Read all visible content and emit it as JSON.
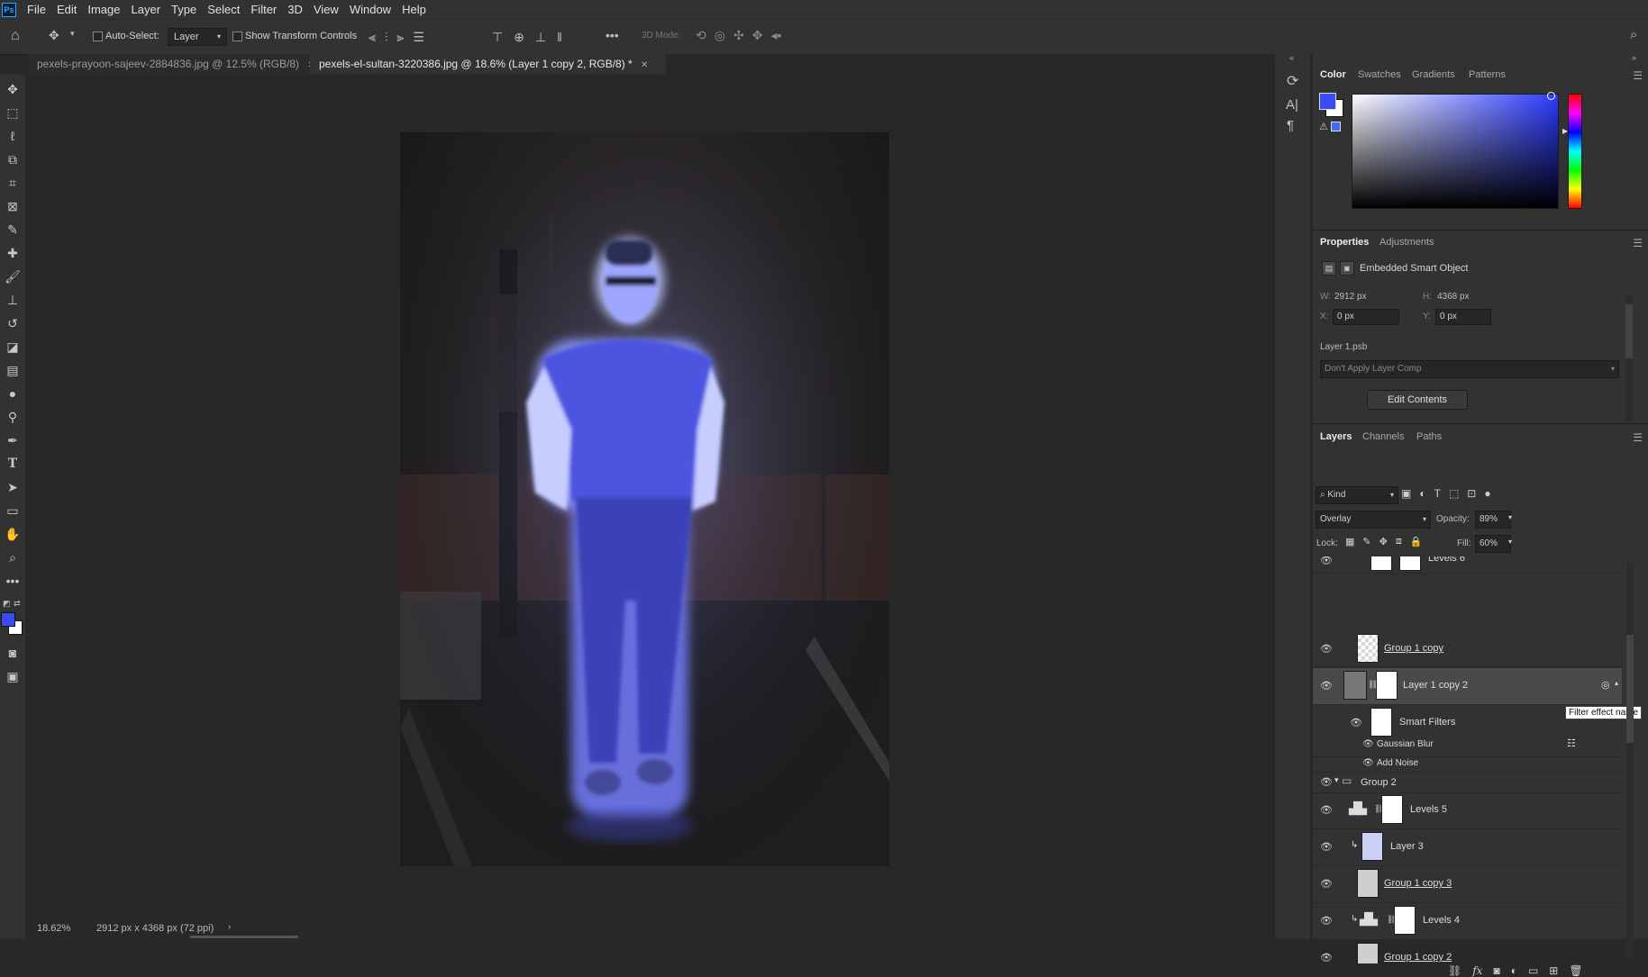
{
  "menubar": {
    "logo": "Ps",
    "items": [
      "File",
      "Edit",
      "Image",
      "Layer",
      "Type",
      "Select",
      "Filter",
      "3D",
      "View",
      "Window",
      "Help"
    ]
  },
  "options": {
    "auto_select_label": "Auto-Select:",
    "auto_select_value": "Layer",
    "show_transform_label": "Show Transform Controls",
    "mode_3d_label": "3D Mode:"
  },
  "tabs": [
    {
      "label": "pexels-prayoon-sajeev-2884836.jpg @ 12.5% (RGB/8)",
      "active": false
    },
    {
      "label": "pexels-el-sultan-3220386.jpg @ 18.6% (Layer 1 copy 2, RGB/8) *",
      "active": true
    }
  ],
  "status": {
    "zoom": "18.62%",
    "doc_info": "2912 px x 4368 px (72 ppi)"
  },
  "colors": {
    "foreground": "#3a4cf5",
    "background": "#ffffff",
    "accent": "#2a3aff"
  },
  "color_panel": {
    "tabs": [
      "Color",
      "Swatches",
      "Gradients",
      "Patterns"
    ],
    "active": "Color"
  },
  "properties": {
    "tabs": [
      "Properties",
      "Adjustments"
    ],
    "active": "Properties",
    "type_label": "Embedded Smart Object",
    "w_label": "W:",
    "w_value": "2912 px",
    "h_label": "H:",
    "h_value": "4368 px",
    "x_label": "X:",
    "x_value": "0 px",
    "y_label": "Y:",
    "y_value": "0 px",
    "file_name": "Layer 1.psb",
    "layer_comp": "Don't Apply Layer Comp",
    "edit_button": "Edit Contents"
  },
  "layers_panel": {
    "tabs": [
      "Layers",
      "Channels",
      "Paths"
    ],
    "active": "Layers",
    "filter_kind": "Kind",
    "blend_mode": "Overlay",
    "opacity_label": "Opacity:",
    "opacity_value": "89%",
    "lock_label": "Lock:",
    "fill_label": "Fill:",
    "fill_value": "60%",
    "partial_top": "Levels 6",
    "rows": {
      "group1copy": "Group 1 copy",
      "layer1copy2": "Layer 1 copy 2",
      "smartfilters": "Smart Filters",
      "gaussian": "Gaussian Blur",
      "addnoise": "Add Noise",
      "group2": "Group 2",
      "levels5": "Levels 5",
      "layer3": "Layer 3",
      "group1copy3": "Group 1 copy 3",
      "levels4": "Levels 4",
      "group1copy2": "Group 1 copy 2"
    },
    "tooltip": "Filter effect name"
  },
  "tool_icons": [
    "move-icon",
    "marquee-icon",
    "lasso-icon",
    "object-select-icon",
    "crop-icon",
    "frame-icon",
    "eyedropper-icon",
    "healing-icon",
    "brush-icon",
    "stamp-icon",
    "history-brush-icon",
    "eraser-icon",
    "gradient-icon",
    "blur-icon",
    "dodge-icon",
    "pen-icon",
    "type-icon",
    "path-select-icon",
    "rectangle-icon",
    "hand-icon",
    "zoom-icon",
    "more-tools-icon"
  ]
}
